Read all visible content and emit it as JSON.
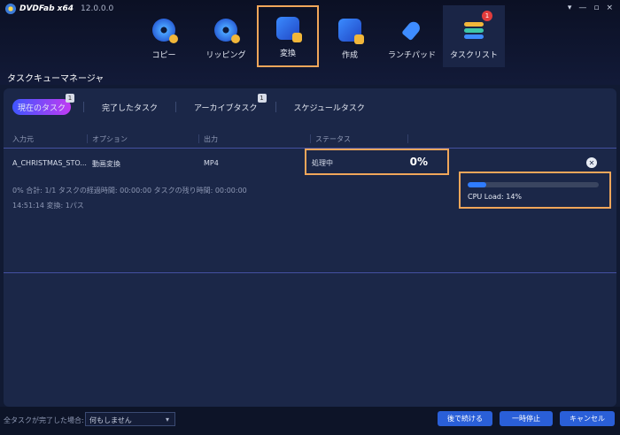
{
  "app": {
    "brand": "DVDFab x64",
    "version": "12.0.0.0",
    "window_controls": [
      "▾",
      "—",
      "▫",
      "×"
    ]
  },
  "nav": {
    "items": [
      {
        "label": "コピー",
        "icon": "disc-copy-icon"
      },
      {
        "label": "リッピング",
        "icon": "disc-rip-icon"
      },
      {
        "label": "変換",
        "icon": "film-convert-icon"
      },
      {
        "label": "作成",
        "icon": "film-create-icon"
      },
      {
        "label": "ランチパッド",
        "icon": "rocket-icon"
      },
      {
        "label": "タスクリスト",
        "icon": "tasklist-icon",
        "badge": "1"
      }
    ]
  },
  "page_title": "タスクキューマネージャ",
  "tabs": [
    {
      "label": "現在のタスク",
      "badge": "1"
    },
    {
      "label": "完了したタスク"
    },
    {
      "label": "アーカイブタスク",
      "badge": "1"
    },
    {
      "label": "スケジュールタスク"
    }
  ],
  "table": {
    "headers": [
      "入力元",
      "オプション",
      "出力",
      "ステータス"
    ],
    "row": {
      "source": "A_CHRISTMAS_STO...",
      "option": "動画変換",
      "output": "MP4",
      "status": "処理中",
      "percent": "0%"
    }
  },
  "info": {
    "line1": "0%  合計: 1/1 タスクの経過時間: 00:00:00 タスクの残り時間: 00:00:00",
    "line2": "14:51:14 変換: 1パス"
  },
  "cpu": {
    "label": "CPU Load: 14%",
    "load": 0.14
  },
  "bottom": {
    "after_label": "全タスクが完了した場合:",
    "after_value": "何もしません",
    "buttons": [
      "後で続ける",
      "一時停止",
      "キャンセル"
    ]
  },
  "colors": {
    "accent": "#2a5fd8",
    "highlight": "#f0a65a"
  }
}
